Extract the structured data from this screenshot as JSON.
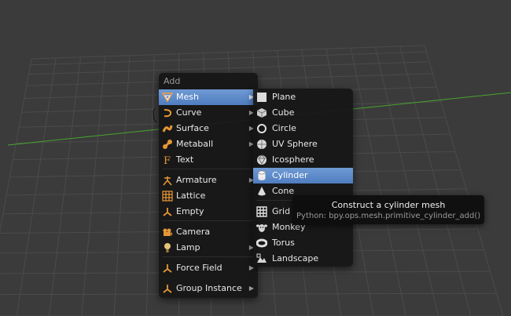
{
  "add_menu": {
    "title": "Add",
    "items": [
      {
        "label": "Mesh",
        "icon": "mesh-icon"
      },
      {
        "label": "Curve",
        "icon": "curve-icon"
      },
      {
        "label": "Surface",
        "icon": "surface-icon"
      },
      {
        "label": "Metaball",
        "icon": "metaball-icon"
      },
      {
        "label": "Text",
        "icon": "text-icon"
      },
      {
        "label": "Armature",
        "icon": "armature-icon"
      },
      {
        "label": "Lattice",
        "icon": "lattice-icon"
      },
      {
        "label": "Empty",
        "icon": "empty-icon"
      },
      {
        "label": "Camera",
        "icon": "camera-icon"
      },
      {
        "label": "Lamp",
        "icon": "lamp-icon"
      },
      {
        "label": "Force Field",
        "icon": "force-field-icon"
      },
      {
        "label": "Group Instance",
        "icon": "group-instance-icon"
      }
    ]
  },
  "mesh_menu": {
    "items": [
      {
        "label": "Plane",
        "icon": "plane-icon"
      },
      {
        "label": "Cube",
        "icon": "cube-icon"
      },
      {
        "label": "Circle",
        "icon": "circle-icon"
      },
      {
        "label": "UV Sphere",
        "icon": "uv-sphere-icon"
      },
      {
        "label": "Icosphere",
        "icon": "icosphere-icon"
      },
      {
        "label": "Cylinder",
        "icon": "cylinder-icon"
      },
      {
        "label": "Cone",
        "icon": "cone-icon"
      },
      {
        "label": "Grid",
        "icon": "grid-icon"
      },
      {
        "label": "Monkey",
        "icon": "monkey-icon"
      },
      {
        "label": "Torus",
        "icon": "torus-icon"
      },
      {
        "label": "Landscape",
        "icon": "landscape-icon"
      }
    ]
  },
  "tooltip": {
    "description": "Construct a cylinder mesh",
    "python": "Python: bpy.ops.mesh.primitive_cylinder_add()"
  },
  "colors": {
    "highlight": "#5a87c8",
    "menu_bg": "#161616",
    "viewport_bg": "#3b3b3b",
    "grid_line": "#4a4a4a",
    "x_axis": "#49a52c",
    "icon_orange": "#e69637"
  }
}
